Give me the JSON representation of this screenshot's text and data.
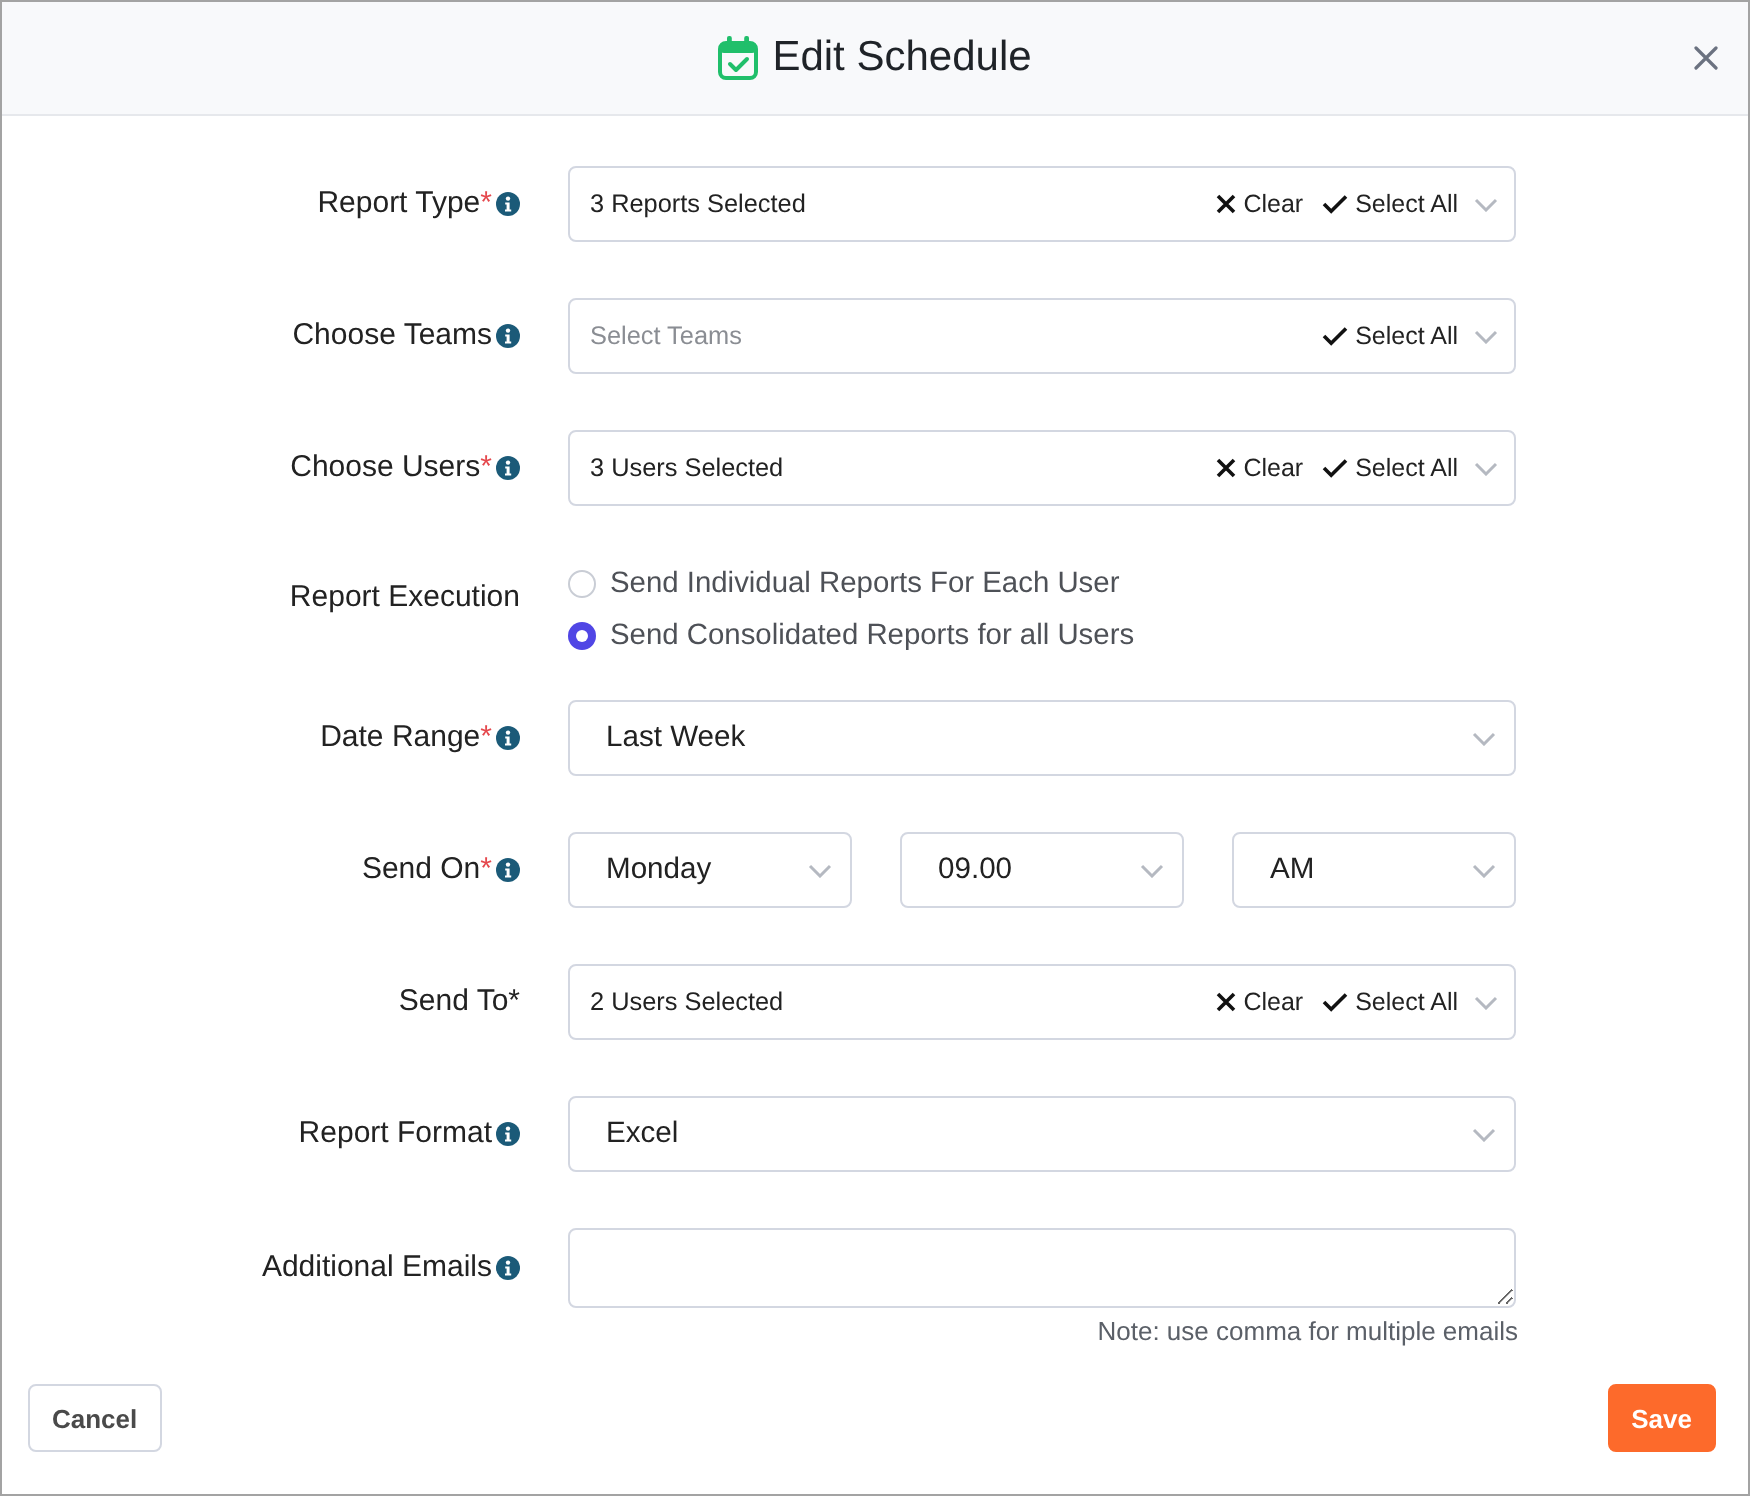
{
  "dialog": {
    "title": "Edit Schedule"
  },
  "rows": [
    {
      "kind": "multiselect",
      "label": "Report Type",
      "asterisk": "*",
      "info": true,
      "value": "3 Reports Selected",
      "actions": [
        {
          "kind": "clear",
          "label": "Clear"
        },
        {
          "kind": "select_all",
          "label": "Select All"
        }
      ]
    },
    {
      "kind": "multiselect",
      "label": "Choose Teams",
      "info": true,
      "placeholder": "Select Teams",
      "actions": [
        {
          "kind": "select_all",
          "label": "Select All"
        }
      ]
    },
    {
      "kind": "multiselect",
      "label": "Choose Users",
      "asterisk": "*",
      "info": true,
      "value": "3 Users Selected",
      "actions": [
        {
          "kind": "clear",
          "label": "Clear"
        },
        {
          "kind": "select_all",
          "label": "Select All"
        }
      ]
    },
    {
      "kind": "radio",
      "label": "Report Execution",
      "info": false,
      "options": [
        {
          "label": "Send Individual Reports For Each User",
          "selected": false
        },
        {
          "label": "Send Consolidated Reports for all Users",
          "selected": true
        }
      ]
    },
    {
      "kind": "select",
      "label": "Date Range",
      "asterisk": "*",
      "info": true,
      "selects": [
        {
          "value": "Last Week"
        }
      ]
    },
    {
      "kind": "select",
      "label": "Send On",
      "asterisk": "*",
      "info": true,
      "selects": [
        {
          "value": "Monday"
        },
        {
          "value": "09.00"
        },
        {
          "value": "AM"
        }
      ]
    },
    {
      "kind": "multiselect",
      "label": "Send To*",
      "info": false,
      "value": "2 Users Selected",
      "actions": [
        {
          "kind": "clear",
          "label": "Clear"
        },
        {
          "kind": "select_all",
          "label": "Select All"
        }
      ]
    },
    {
      "kind": "select",
      "label": "Report Format",
      "info": true,
      "selects": [
        {
          "value": "Excel"
        }
      ]
    },
    {
      "kind": "textarea",
      "label": "Additional Emails",
      "info": true,
      "note": "Note: use comma for multiple emails"
    }
  ],
  "buttons": [
    {
      "kind": "secondary",
      "label": "Cancel"
    },
    {
      "kind": "primary",
      "label": "Save"
    }
  ]
}
